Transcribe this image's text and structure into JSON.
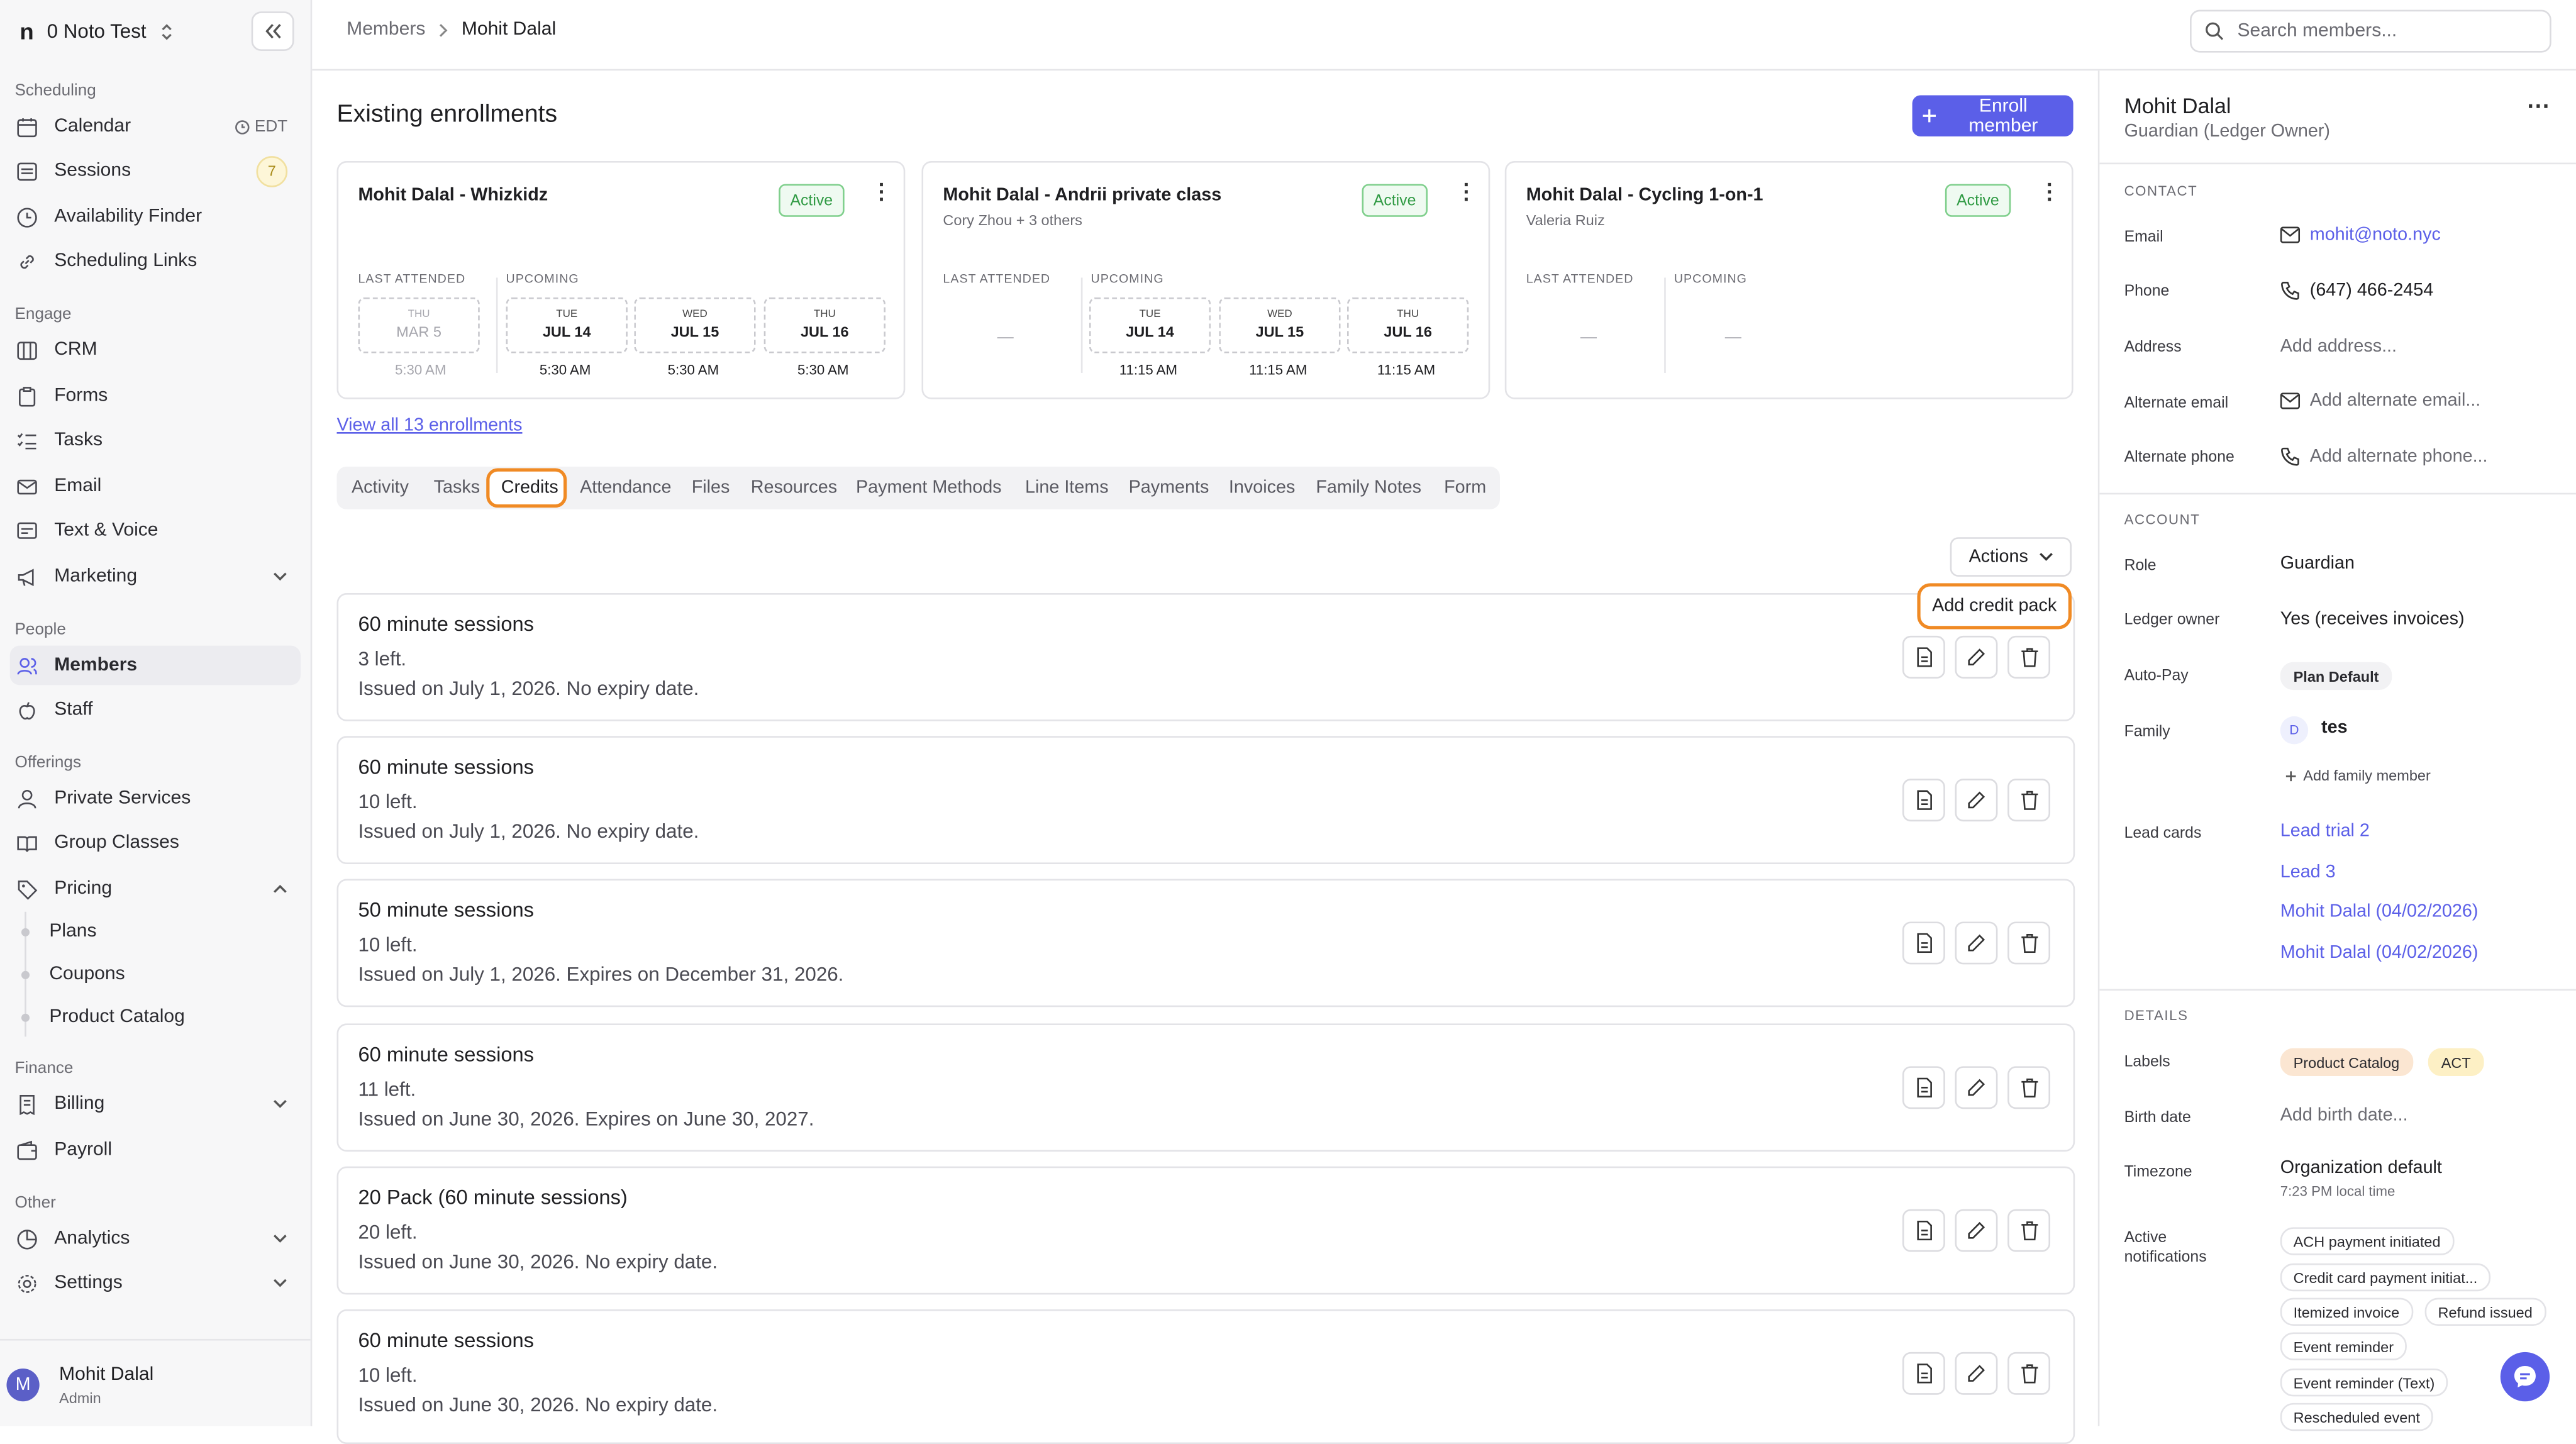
{
  "sidebar": {
    "org_logo": "n",
    "org_name": "0 Noto Test",
    "sections": {
      "scheduling": "Scheduling",
      "engage": "Engage",
      "people": "People",
      "offerings": "Offerings",
      "finance": "Finance",
      "other": "Other"
    },
    "items": {
      "calendar": "Calendar",
      "calendar_tz": "EDT",
      "sessions": "Sessions",
      "sessions_badge": "7",
      "availability": "Availability Finder",
      "links": "Scheduling Links",
      "crm": "CRM",
      "forms": "Forms",
      "tasks": "Tasks",
      "email": "Email",
      "text_voice": "Text & Voice",
      "marketing": "Marketing",
      "members": "Members",
      "staff": "Staff",
      "private": "Private Services",
      "group": "Group Classes",
      "pricing": "Pricing",
      "plans": "Plans",
      "coupons": "Coupons",
      "catalog": "Product Catalog",
      "billing": "Billing",
      "payroll": "Payroll",
      "analytics": "Analytics",
      "settings": "Settings"
    },
    "user": {
      "initial": "M",
      "name": "Mohit Dalal",
      "role": "Admin"
    }
  },
  "topbar": {
    "crumb_parent": "Members",
    "crumb_current": "Mohit Dalal",
    "search_placeholder": "Search members..."
  },
  "main": {
    "heading": "Existing enrollments",
    "enroll_label": "Enroll member",
    "view_all": "View all 13 enrollments",
    "last_attended_label": "LAST ATTENDED",
    "upcoming_label": "UPCOMING",
    "active_label": "Active",
    "dash": "—",
    "cards": [
      {
        "title": "Mohit Dalal - Whizkidz",
        "subtitle": "",
        "last": {
          "dow": "THU",
          "date": "MAR 5",
          "time": "5:30 AM"
        },
        "upcoming": [
          {
            "dow": "TUE",
            "date": "JUL 14",
            "time": "5:30 AM"
          },
          {
            "dow": "WED",
            "date": "JUL 15",
            "time": "5:30 AM"
          },
          {
            "dow": "THU",
            "date": "JUL 16",
            "time": "5:30 AM"
          }
        ]
      },
      {
        "title": "Mohit Dalal - Andrii private class",
        "subtitle": "Cory Zhou + 3 others",
        "upcoming": [
          {
            "dow": "TUE",
            "date": "JUL 14",
            "time": "11:15 AM"
          },
          {
            "dow": "WED",
            "date": "JUL 15",
            "time": "11:15 AM"
          },
          {
            "dow": "THU",
            "date": "JUL 16",
            "time": "11:15 AM"
          }
        ]
      },
      {
        "title": "Mohit Dalal - Cycling 1-on-1",
        "subtitle": "Valeria Ruiz"
      }
    ],
    "tabs": [
      "Activity",
      "Tasks",
      "Credits",
      "Attendance",
      "Files",
      "Resources",
      "Payment Methods",
      "Line Items",
      "Payments",
      "Invoices",
      "Family Notes",
      "Form"
    ],
    "active_tab": "Credits",
    "actions_label": "Actions",
    "menu_add_credit": "Add credit pack",
    "credits": [
      {
        "title": "60 minute sessions",
        "left": "3 left.",
        "issued": "Issued on July 1, 2026. No expiry date."
      },
      {
        "title": "60 minute sessions",
        "left": "10 left.",
        "issued": "Issued on July 1, 2026. No expiry date."
      },
      {
        "title": "50 minute sessions",
        "left": "10 left.",
        "issued": "Issued on July 1, 2026. Expires on December 31, 2026."
      },
      {
        "title": "60 minute sessions",
        "left": "11 left.",
        "issued": "Issued on June 30, 2026. Expires on June 30, 2027."
      },
      {
        "title": "20 Pack (60 minute sessions)",
        "left": "20 left.",
        "issued": "Issued on June 30, 2026. No expiry date."
      },
      {
        "title": "60 minute sessions",
        "left": "10 left.",
        "issued": "Issued on June 30, 2026. No expiry date."
      }
    ]
  },
  "profile": {
    "name": "Mohit Dalal",
    "role": "Guardian (Ledger Owner)",
    "contact_title": "CONTACT",
    "email_label": "Email",
    "email": "mohit@noto.nyc",
    "phone_label": "Phone",
    "phone": "(647) 466-2454",
    "address_label": "Address",
    "address_ph": "Add address...",
    "alt_email_label": "Alternate email",
    "alt_email_ph": "Add alternate email...",
    "alt_phone_label": "Alternate phone",
    "alt_phone_ph": "Add alternate phone...",
    "account_title": "ACCOUNT",
    "role_label": "Role",
    "role_value": "Guardian",
    "ledger_label": "Ledger owner",
    "ledger_value": "Yes (receives invoices)",
    "autopay_label": "Auto-Pay",
    "autopay_value": "Plan Default",
    "family_label": "Family",
    "family_initial": "D",
    "family_value": "tes",
    "add_family": "Add family member",
    "lead_label": "Lead cards",
    "leads": [
      "Lead trial 2",
      "Lead 3",
      "Mohit Dalal (04/02/2026)",
      "Mohit Dalal (04/02/2026)"
    ],
    "details_title": "DETAILS",
    "labels_label": "Labels",
    "labels": [
      "Product Catalog",
      "ACT"
    ],
    "birth_label": "Birth date",
    "birth_ph": "Add birth date...",
    "tz_label": "Timezone",
    "tz_value": "Organization default",
    "tz_local": "7:23 PM local time",
    "notif_label_1": "Active",
    "notif_label_2": "notifications",
    "notifications": [
      "ACH payment initiated",
      "Credit card payment initiat...",
      "Itemized invoice",
      "Refund issued",
      "Event reminder",
      "Event reminder (Text)",
      "Rescheduled event"
    ]
  },
  "colors": {
    "accent": "#5b5fe8",
    "highlight": "#f08a24",
    "active_green": "#2f9a43"
  }
}
